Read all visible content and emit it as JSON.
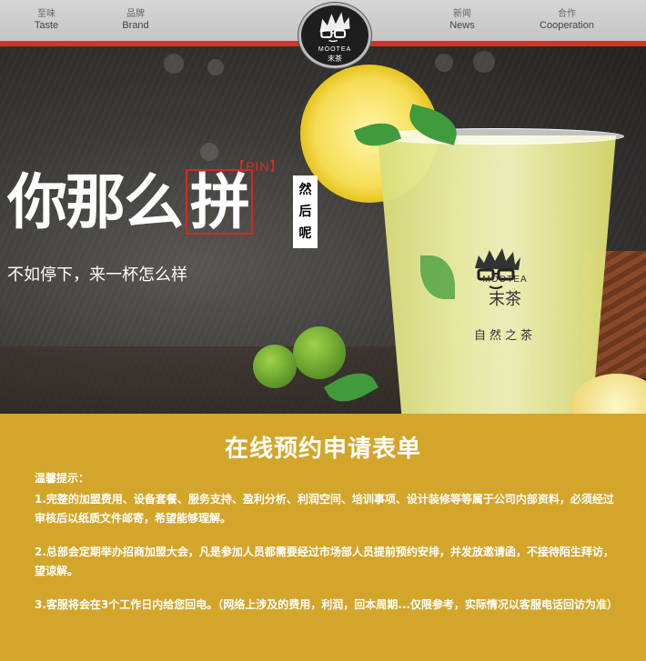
{
  "nav": {
    "items": [
      {
        "cn": "至味",
        "en": "Taste"
      },
      {
        "cn": "品牌",
        "en": "Brand"
      },
      {
        "cn": "新闻",
        "en": "News"
      },
      {
        "cn": "合作",
        "en": "Cooperation"
      }
    ],
    "logo": {
      "en": "MOOTEA",
      "cn": "末茶"
    }
  },
  "hero": {
    "pin_tag": "【PIN】",
    "headline_main": "你那么",
    "headline_boxed": "拼",
    "side_text": [
      "然",
      "后",
      "呢"
    ],
    "tagline": "不如停下，来一杯怎么样",
    "cup": {
      "brand_en": "MOOTEA",
      "brand_cn": "末茶",
      "slogan": "自然之茶"
    }
  },
  "form": {
    "title": "在线预约申请表单",
    "tips_label": "温馨提示：",
    "tips": [
      "1.完整的加盟费用、设备套餐、服务支持、盈利分析、利润空间、培训事项、设计装修等等属于公司内部资料，必须经过审核后以纸质文件邮寄，希望能够理解。",
      "2.总部会定期举办招商加盟大会，凡是参加人员都需要经过市场部人员提前预约安排，并发放邀请函，不接待陌生拜访，望谅解。",
      "3.客服将会在3个工作日内给您回电。（网络上涉及的费用，利润，回本周期...仅限参考，实际情况以客服电话回访为准）"
    ]
  },
  "colors": {
    "accent_red": "#d9302b",
    "form_bg": "#d3a52a",
    "nav_bg": "#cfcfcf"
  }
}
